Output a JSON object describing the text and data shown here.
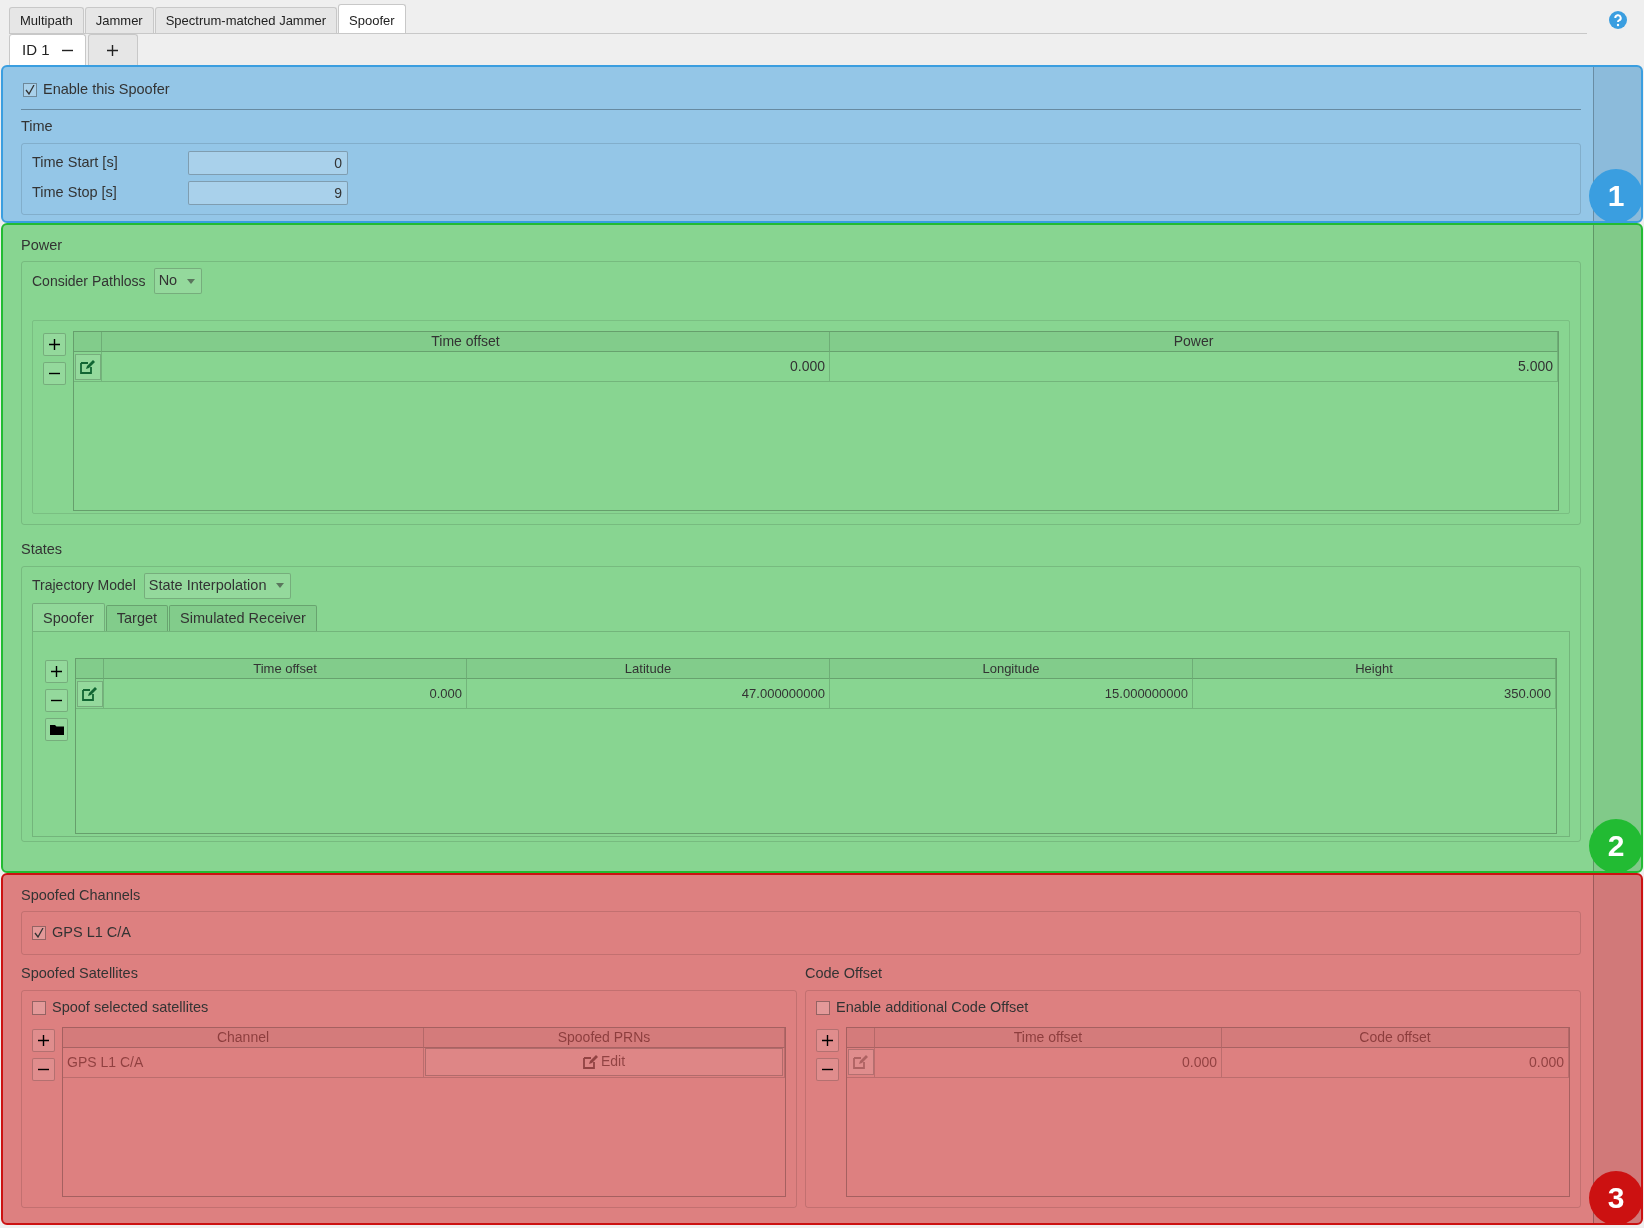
{
  "top_tabs": [
    {
      "label": "Multipath",
      "selected": false
    },
    {
      "label": "Jammer",
      "selected": false
    },
    {
      "label": "Spectrum-matched Jammer",
      "selected": false
    },
    {
      "label": "Spoofer",
      "selected": true
    }
  ],
  "id_tabs": [
    {
      "label": "ID 1",
      "selected": true,
      "kind": "item"
    },
    {
      "selected": false,
      "kind": "add"
    }
  ],
  "regions": [
    {
      "number": "1",
      "color": "#3a9ee0",
      "kind": "general",
      "enable": {
        "label": "Enable this Spoofer",
        "checked": true
      },
      "time": {
        "title": "Time",
        "fields": [
          {
            "label": "Time Start [s]",
            "value": "0"
          },
          {
            "label": "Time Stop [s]",
            "value": "9"
          }
        ]
      }
    },
    {
      "number": "2",
      "color": "#22bb33",
      "kind": "motion",
      "power": {
        "title": "Power",
        "pathloss": {
          "label": "Consider Pathloss",
          "value": "No"
        },
        "table": {
          "disabled": false,
          "columns": [
            "Time offset",
            "Power"
          ],
          "rows": [
            [
              "0.000",
              "5.000"
            ]
          ]
        }
      },
      "states": {
        "title": "States",
        "trajectory": {
          "label": "Trajectory Model",
          "value": "State Interpolation"
        },
        "tabs": [
          {
            "label": "Spoofer",
            "selected": true
          },
          {
            "label": "Target",
            "selected": false
          },
          {
            "label": "Simulated Receiver",
            "selected": false
          }
        ],
        "table": {
          "disabled": false,
          "columns": [
            "Time offset",
            "Latitude",
            "Longitude",
            "Height"
          ],
          "rows": [
            [
              "0.000",
              "47.000000000",
              "15.000000000",
              "350.000"
            ]
          ]
        }
      }
    },
    {
      "number": "3",
      "color": "#cc1111",
      "kind": "spoofing",
      "channels": {
        "title": "Spoofed Channels",
        "items": [
          {
            "label": "GPS L1 C/A",
            "checked": true
          }
        ]
      },
      "satellites": {
        "title": "Spoofed Satellites",
        "option": {
          "label": "Spoof selected satellites",
          "checked": false
        },
        "table": {
          "disabled": true,
          "columns": [
            "Channel",
            "Spoofed PRNs"
          ],
          "rows": [
            [
              {
                "kind": "text",
                "text": "GPS L1 C/A"
              },
              {
                "kind": "button",
                "text": "Edit"
              }
            ]
          ]
        }
      },
      "code_offset": {
        "title": "Code Offset",
        "option": {
          "label": "Enable additional Code Offset",
          "checked": false
        },
        "table": {
          "disabled": true,
          "columns": [
            "Time offset",
            "Code offset"
          ],
          "rows": [
            [
              "0.000",
              "0.000"
            ]
          ]
        }
      }
    }
  ]
}
